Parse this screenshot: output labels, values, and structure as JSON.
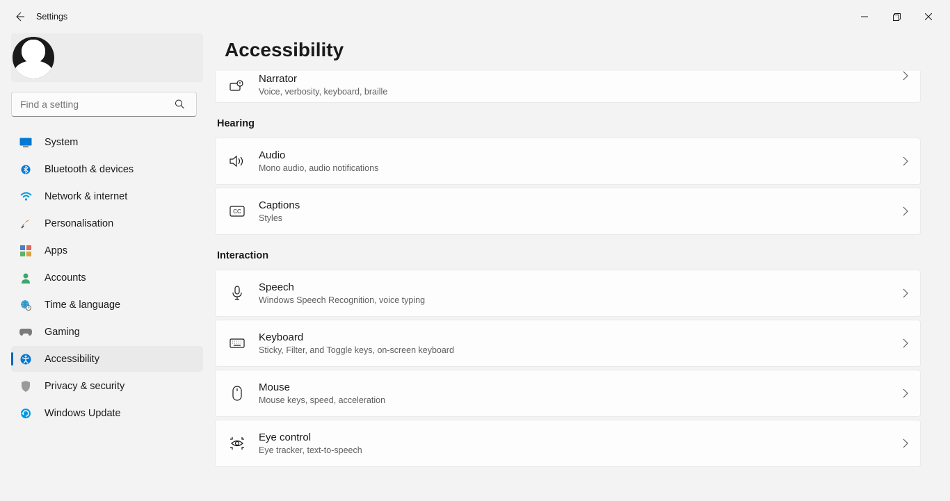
{
  "app": {
    "title": "Settings"
  },
  "search": {
    "placeholder": "Find a setting"
  },
  "nav": {
    "items": [
      {
        "id": "system",
        "label": "System"
      },
      {
        "id": "bluetooth",
        "label": "Bluetooth & devices"
      },
      {
        "id": "network",
        "label": "Network & internet"
      },
      {
        "id": "personalisation",
        "label": "Personalisation"
      },
      {
        "id": "apps",
        "label": "Apps"
      },
      {
        "id": "accounts",
        "label": "Accounts"
      },
      {
        "id": "time",
        "label": "Time & language"
      },
      {
        "id": "gaming",
        "label": "Gaming"
      },
      {
        "id": "accessibility",
        "label": "Accessibility"
      },
      {
        "id": "privacy",
        "label": "Privacy & security"
      },
      {
        "id": "update",
        "label": "Windows Update"
      }
    ],
    "selected": "accessibility"
  },
  "page": {
    "title": "Accessibility",
    "sections": {
      "narrator": {
        "title": "Narrator",
        "sub": "Voice, verbosity, keyboard, braille"
      },
      "hearing_header": "Hearing",
      "audio": {
        "title": "Audio",
        "sub": "Mono audio, audio notifications"
      },
      "captions": {
        "title": "Captions",
        "sub": "Styles"
      },
      "interaction_header": "Interaction",
      "speech": {
        "title": "Speech",
        "sub": "Windows Speech Recognition, voice typing"
      },
      "keyboard": {
        "title": "Keyboard",
        "sub": "Sticky, Filter, and Toggle keys, on-screen keyboard"
      },
      "mouse": {
        "title": "Mouse",
        "sub": "Mouse keys, speed, acceleration"
      },
      "eye": {
        "title": "Eye control",
        "sub": "Eye tracker, text-to-speech"
      }
    }
  }
}
